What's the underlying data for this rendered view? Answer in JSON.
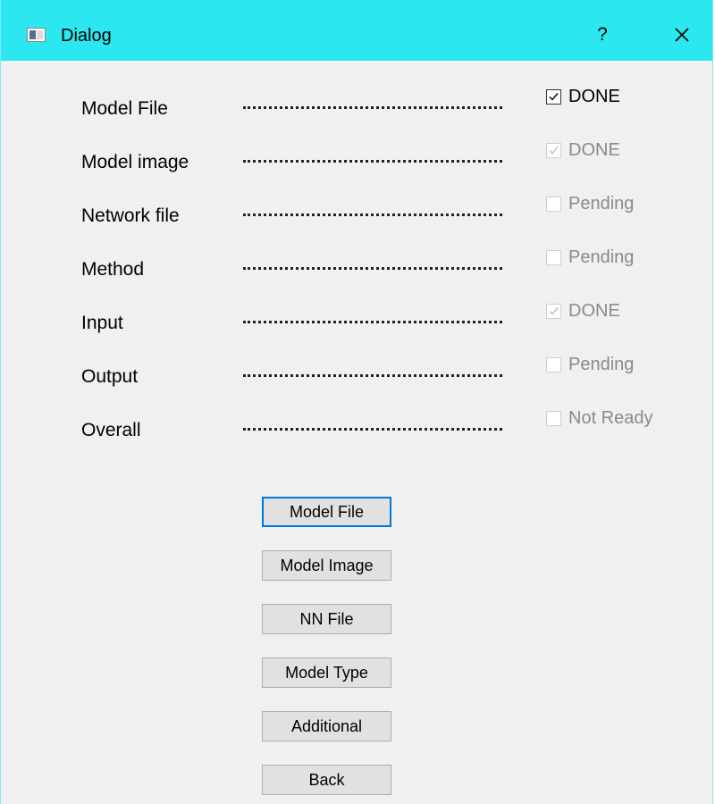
{
  "window": {
    "title": "Dialog",
    "help_label": "?",
    "accent_color": "#2ce7ef"
  },
  "rows": [
    {
      "label": "Model File",
      "status": "DONE",
      "checked": true,
      "enabled": true
    },
    {
      "label": "Model image",
      "status": "DONE",
      "checked": true,
      "enabled": false
    },
    {
      "label": "Network file",
      "status": "Pending",
      "checked": false,
      "enabled": false
    },
    {
      "label": "Method",
      "status": "Pending",
      "checked": false,
      "enabled": false
    },
    {
      "label": "Input",
      "status": "DONE",
      "checked": true,
      "enabled": false
    },
    {
      "label": "Output",
      "status": "Pending",
      "checked": false,
      "enabled": false
    },
    {
      "label": "Overall",
      "status": "Not Ready",
      "checked": false,
      "enabled": false
    }
  ],
  "buttons": [
    {
      "label": "Model File",
      "focused": true
    },
    {
      "label": "Model Image",
      "focused": false
    },
    {
      "label": "NN File",
      "focused": false
    },
    {
      "label": "Model Type",
      "focused": false
    },
    {
      "label": "Additional",
      "focused": false
    },
    {
      "label": "Back",
      "focused": false
    }
  ],
  "icons": {
    "app": "app-window-icon",
    "help": "help-icon",
    "close": "close-icon",
    "check": "checkmark-icon"
  }
}
